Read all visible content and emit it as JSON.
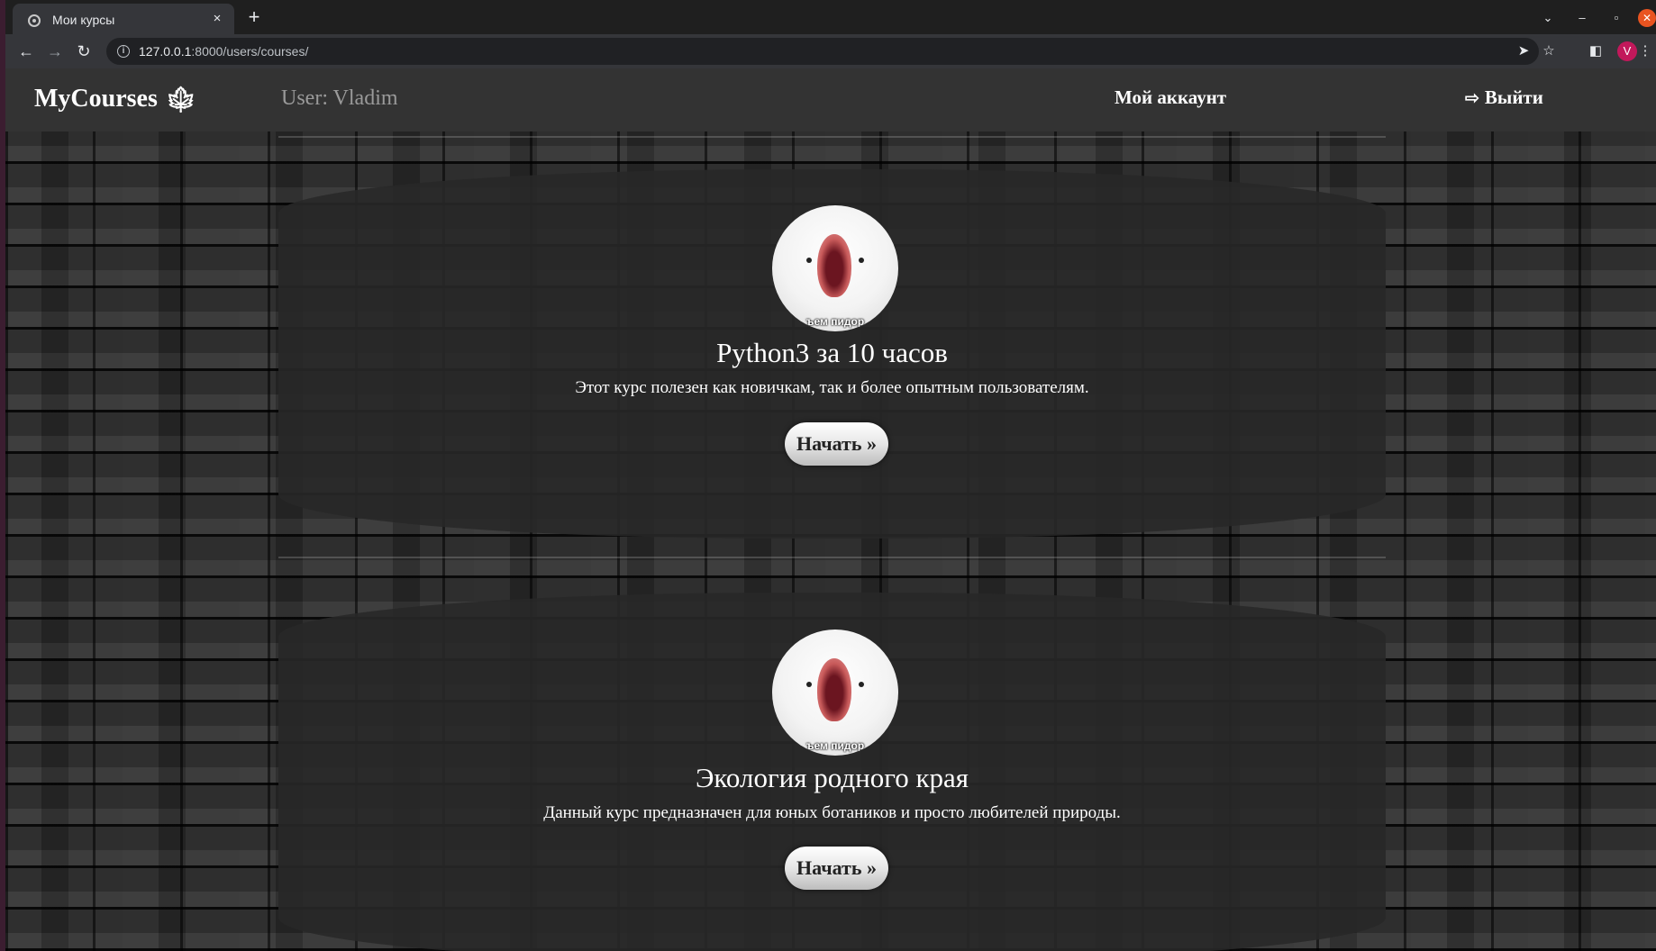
{
  "browser": {
    "tab_title": "Мои курсы",
    "tab_close": "×",
    "new_tab": "+",
    "url_host": "127.0.0.1",
    "url_rest": ":8000/users/courses/",
    "profile_initial": "V",
    "icons": [
      "back-icon",
      "forward-icon",
      "reload-icon",
      "info-icon",
      "send-icon",
      "star-icon",
      "sidepanel-icon",
      "menu-icon"
    ]
  },
  "nav": {
    "brand": "MyCourses",
    "user_label": "User: Vladim",
    "account_link": "Мой аккаунт",
    "logout_link": "Выйти"
  },
  "courses": [
    {
      "title": "Python3 за 10 часов",
      "description": "Этот курс полезен как новичкам, так и более опытным пользователям.",
      "image_caption": "ъем пидор",
      "button": "Начать »"
    },
    {
      "title": "Экология родного края",
      "description": "Данный курс предназначен для юных ботаников и просто любителей природы.",
      "image_caption": "ъем пидор",
      "button": "Начать »"
    }
  ],
  "colors": {
    "navbar": "#333333",
    "card": "#282828",
    "accent_close": "#e95420",
    "profile": "#c2185b"
  }
}
